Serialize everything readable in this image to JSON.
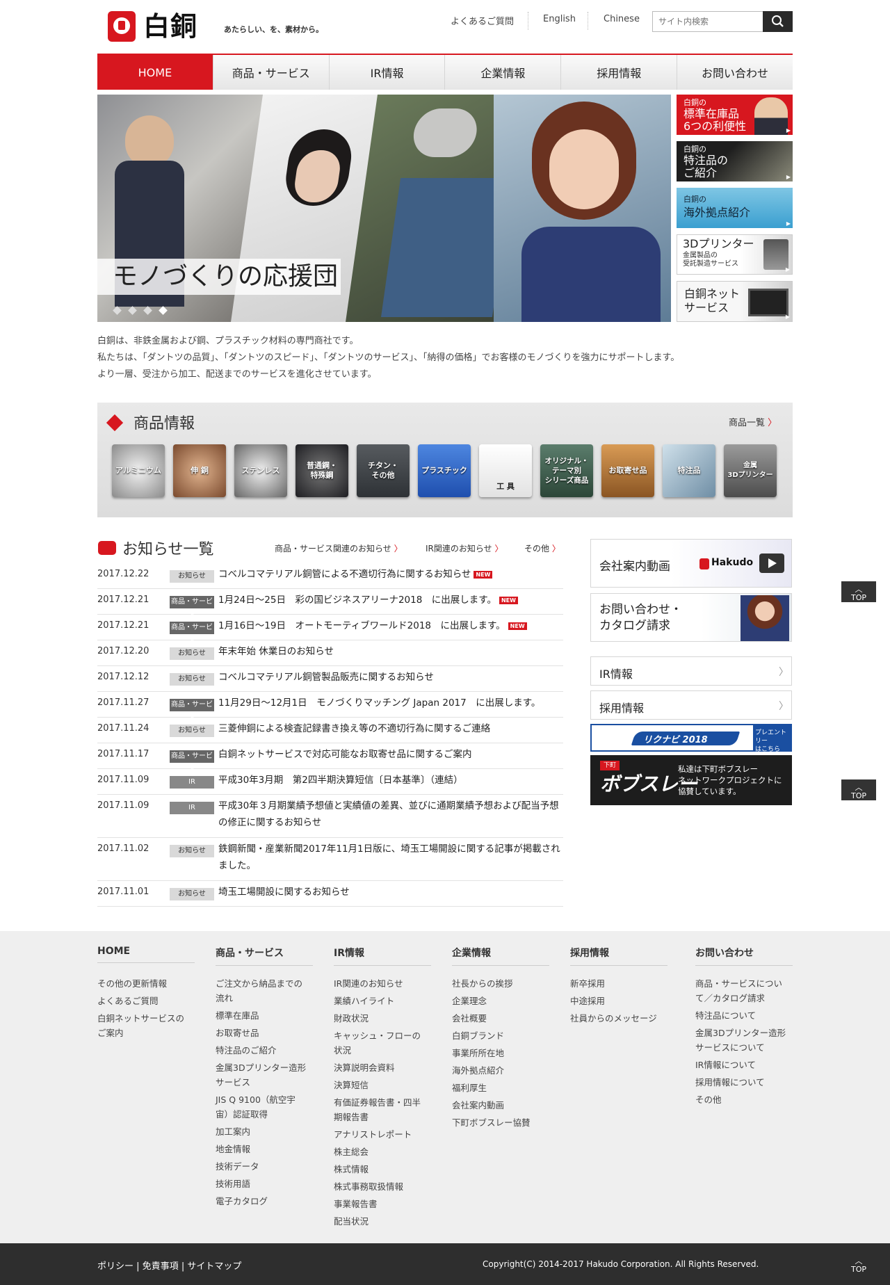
{
  "header": {
    "logo_text": "白銅",
    "tagline": "あたらしい、を、素材から。",
    "util_links": [
      "よくあるご質問",
      "English",
      "Chinese"
    ],
    "search_placeholder": "サイト内検索"
  },
  "nav": {
    "items": [
      "HOME",
      "商品・サービス",
      "IR情報",
      "企業情報",
      "採用情報",
      "お問い合わせ"
    ]
  },
  "hero": {
    "caption": "モノづくりの応援団"
  },
  "side_banners": [
    {
      "small": "白銅の",
      "big": "標準在庫品\n6つの利便性"
    },
    {
      "small": "白銅の",
      "big": "特注品の\nご紹介"
    },
    {
      "small": "白銅の",
      "big": "海外拠点紹介"
    },
    {
      "big": "3Dプリンター",
      "small": "金属製品の\n受託製造サービス"
    },
    {
      "big": "白銅ネット\nサービス"
    }
  ],
  "intro": [
    "白銅は、非鉄金属および鋼、プラスチック材料の専門商社です。",
    "私たちは、「ダントツの品質」、「ダントツのスピード」、「ダントツのサービス」、「納得の価格」でお客様のモノづくりを強力にサポートします。",
    "より一層、受注から加工、配送までのサービスを進化させています。"
  ],
  "products": {
    "title": "商品情報",
    "all_link": "商品一覧",
    "tiles": [
      "アルミニウム",
      "伸 銅",
      "ステンレス",
      "普通鋼・\n特殊鋼",
      "チタン・\nその他",
      "プラスチック",
      "工 具",
      "オリジナル・\nテーマ別\nシリーズ商品",
      "お取寄せ品",
      "特注品",
      "金属\n3Dプリンター"
    ]
  },
  "news": {
    "title": "お知らせ一覧",
    "categories": [
      "商品・サービス関連のお知らせ",
      "IR関連のお知らせ",
      "その他"
    ],
    "new_label": "NEW",
    "items": [
      {
        "date": "2017.12.22",
        "badge": "お知らせ",
        "text": "コベルコマテリアル銅管による不適切行為に関するお知らせ",
        "new": true
      },
      {
        "date": "2017.12.21",
        "badge": "商品・サービス",
        "text": "1月24日～25日　彩の国ビジネスアリーナ2018　に出展します。",
        "new": true
      },
      {
        "date": "2017.12.21",
        "badge": "商品・サービス",
        "text": "1月16日～19日　オートモーティブワールド2018　に出展します。",
        "new": true
      },
      {
        "date": "2017.12.20",
        "badge": "お知らせ",
        "text": "年末年始 休業日のお知らせ",
        "new": false
      },
      {
        "date": "2017.12.12",
        "badge": "お知らせ",
        "text": "コベルコマテリアル銅管製品販売に関するお知らせ",
        "new": false
      },
      {
        "date": "2017.11.27",
        "badge": "商品・サービス",
        "text": "11月29日～12月1日　モノづくりマッチング Japan 2017　に出展します。",
        "new": false
      },
      {
        "date": "2017.11.24",
        "badge": "お知らせ",
        "text": "三菱伸銅による検査記録書き換え等の不適切行為に関するご連絡",
        "new": false
      },
      {
        "date": "2017.11.17",
        "badge": "商品・サービス",
        "text": "白銅ネットサービスで対応可能なお取寄せ品に関するご案内",
        "new": false
      },
      {
        "date": "2017.11.09",
        "badge": "IR",
        "text": "平成30年3月期　第2四半期決算短信〔日本基準〕（連結）",
        "new": false
      },
      {
        "date": "2017.11.09",
        "badge": "IR",
        "text": "平成30年３月期業績予想値と実績値の差異、並びに通期業績予想および配当予想の修正に関するお知らせ",
        "new": false
      },
      {
        "date": "2017.11.02",
        "badge": "お知らせ",
        "text": "鉄鋼新聞・産業新聞2017年11月1日版に、埼玉工場開設に関する記事が掲載されました。",
        "new": false
      },
      {
        "date": "2017.11.01",
        "badge": "お知らせ",
        "text": "埼玉工場開設に関するお知らせ",
        "new": false
      }
    ]
  },
  "right": {
    "video": "会社案内動画",
    "video_brand": "Hakudo",
    "contact": "お問い合わせ・\nカタログ請求",
    "ir": "IR情報",
    "recruit": "採用情報",
    "rikunabi": "リクナビ 2018",
    "rikunabi_side": "プレエントリー\nはこちら",
    "bobsleigh_logo": "ボブスレー",
    "bobsleigh_stamp": "下町",
    "bobsleigh_text": "私達は下町ボブスレー\nネットワークプロジェクトに\n協賛しています。"
  },
  "footer": {
    "columns": [
      {
        "title": "HOME",
        "links": [
          "その他の更新情報",
          "よくあるご質問",
          "白銅ネットサービスの\nご案内"
        ]
      },
      {
        "title": "商品・サービス",
        "links": [
          "ご注文から納品までの\n流れ",
          "標準在庫品",
          "お取寄せ品",
          "特注品のご紹介",
          "金属3Dプリンター造形\nサービス",
          "JIS Q 9100（航空宇\n宙）認証取得",
          "加工案内",
          "地金情報",
          "技術データ",
          "技術用語",
          "電子カタログ"
        ]
      },
      {
        "title": "IR情報",
        "links": [
          "IR関連のお知らせ",
          "業績ハイライト",
          "財政状況",
          "キャッシュ・フローの\n状況",
          "決算説明会資料",
          "決算短信",
          "有価証券報告書・四半\n期報告書",
          "アナリストレポート",
          "株主総会",
          "株式情報",
          "株式事務取扱情報",
          "事業報告書",
          "配当状況"
        ]
      },
      {
        "title": "企業情報",
        "links": [
          "社長からの挨拶",
          "企業理念",
          "会社概要",
          "白銅ブランド",
          "事業所所在地",
          "海外拠点紹介",
          "福利厚生",
          "会社案内動画",
          "下町ボブスレー協賛"
        ]
      },
      {
        "title": "採用情報",
        "links": [
          "新卒採用",
          "中途採用",
          "社員からのメッセージ"
        ]
      },
      {
        "title": "お問い合わせ",
        "links": [
          "商品・サービスについ\nて／カタログ請求",
          "特注品について",
          "金属3Dプリンター造形\nサービスについて",
          "IR情報について",
          "採用情報について",
          "その他"
        ]
      }
    ],
    "bottom_links": [
      "ポリシー",
      "免責事項",
      "サイトマップ"
    ],
    "copyright": "Copyright(C) 2014-2017 Hakudo Corporation. All Rights Reserved.",
    "top_label": "TOP"
  },
  "colors": {
    "brand_red": "#d7171f",
    "dark": "#2e2e2e"
  }
}
